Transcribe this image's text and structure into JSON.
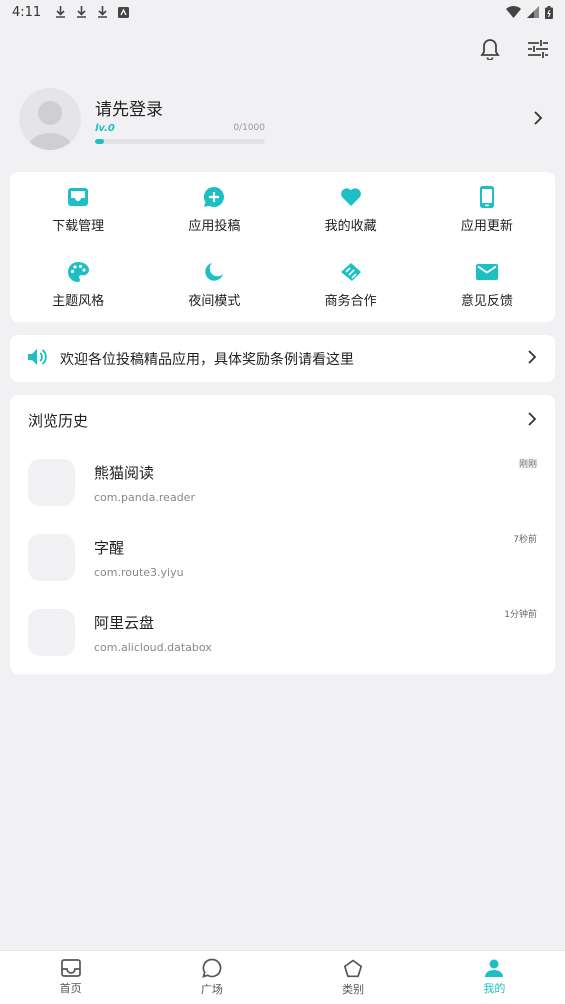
{
  "status_bar": {
    "time": "4:11"
  },
  "profile": {
    "name": "请先登录",
    "level": "lv.0",
    "exp_text": "0/1000",
    "exp_progress": 0.05
  },
  "colors": {
    "accent": "#1bbfc4",
    "background": "#f1f1f4"
  },
  "grid": [
    {
      "label": "下载管理",
      "icon": "inbox-icon"
    },
    {
      "label": "应用投稿",
      "icon": "add-chat-icon"
    },
    {
      "label": "我的收藏",
      "icon": "heart-icon"
    },
    {
      "label": "应用更新",
      "icon": "phone-icon"
    },
    {
      "label": "主题风格",
      "icon": "palette-icon"
    },
    {
      "label": "夜间模式",
      "icon": "moon-icon"
    },
    {
      "label": "商务合作",
      "icon": "handshake-icon"
    },
    {
      "label": "意见反馈",
      "icon": "mail-icon"
    }
  ],
  "notice": {
    "text": "欢迎各位投稿精品应用，具体奖励条例请看这里",
    "icon": "speaker-icon"
  },
  "history": {
    "title": "浏览历史",
    "items": [
      {
        "name": "熊猫阅读",
        "package": "com.panda.reader",
        "time": "刚刚"
      },
      {
        "name": "字醒",
        "package": "com.route3.yiyu",
        "time": "7秒前"
      },
      {
        "name": "阿里云盘",
        "package": "com.alicloud.databox",
        "time": "1分钟前"
      }
    ]
  },
  "bottom_nav": [
    {
      "label": "首页",
      "icon": "home-inbox-icon"
    },
    {
      "label": "广场",
      "icon": "chat-bubble-icon"
    },
    {
      "label": "类别",
      "icon": "pentagon-icon"
    },
    {
      "label": "我的",
      "icon": "person-icon",
      "active": true
    }
  ]
}
